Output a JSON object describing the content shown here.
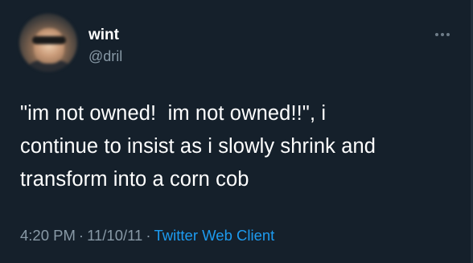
{
  "tweet": {
    "author": {
      "display_name": "wint",
      "handle": "@dril"
    },
    "text": "\"im not owned!  im not owned!!\", i continue to insist as i slowly shrink and transform into a corn cob",
    "text_lines": [
      "\"im not owned!  im not owned!!\", i",
      "continue to insist as i slowly shrink and",
      "transform into a corn cob"
    ],
    "time": "4:20 PM",
    "date": "11/10/11",
    "separator": "·",
    "client": "Twitter Web Client",
    "more_icon": "more-horizontal-icon"
  },
  "colors": {
    "background": "#15202b",
    "primary_text": "#ffffff",
    "secondary_text": "#8899a6",
    "link": "#1d9bf0"
  }
}
